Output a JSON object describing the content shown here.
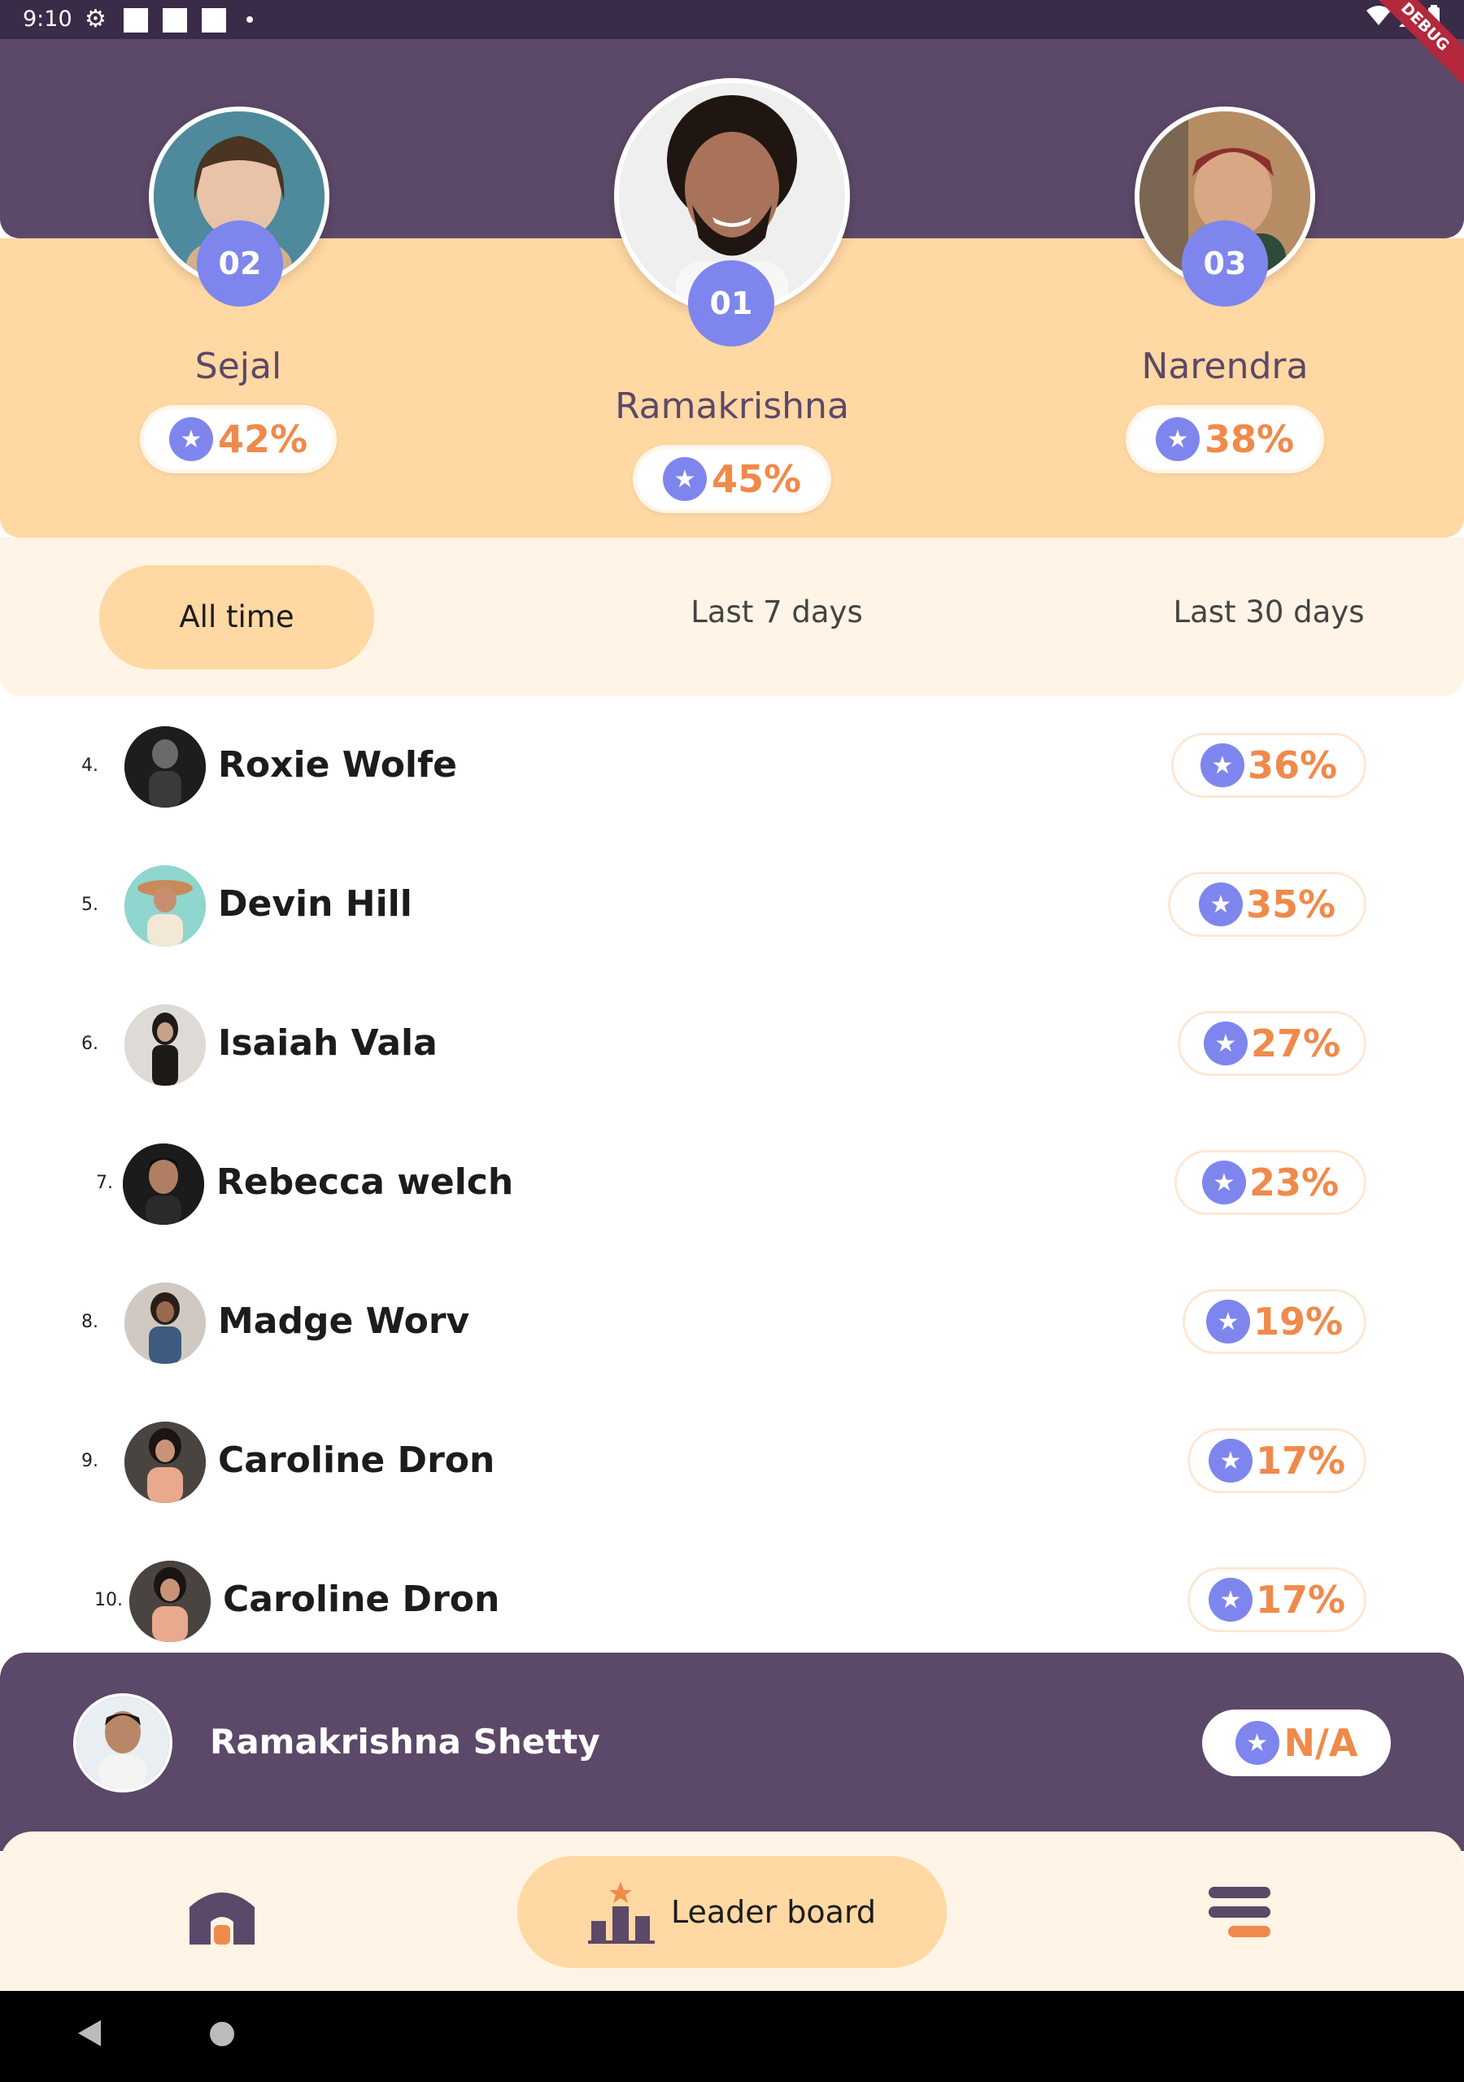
{
  "status_bar": {
    "time": "9:10",
    "debug_label": "DEBUG"
  },
  "podium": [
    {
      "rank": "02",
      "name": "Sejal",
      "score": "42%"
    },
    {
      "rank": "01",
      "name": "Ramakrishna",
      "score": "45%"
    },
    {
      "rank": "03",
      "name": "Narendra",
      "score": "38%"
    }
  ],
  "tabs": [
    {
      "label": "All time",
      "active": true
    },
    {
      "label": "Last 7 days",
      "active": false
    },
    {
      "label": "Last 30 days",
      "active": false
    }
  ],
  "leaderboard": [
    {
      "rank": "4.",
      "name": "Roxie Wolfe",
      "score": "36%"
    },
    {
      "rank": "5.",
      "name": "Devin Hill",
      "score": "35%"
    },
    {
      "rank": "6.",
      "name": "Isaiah Vala",
      "score": "27%"
    },
    {
      "rank": "7.",
      "name": "Rebecca welch",
      "score": "23%"
    },
    {
      "rank": "8.",
      "name": "Madge Worv",
      "score": "19%"
    },
    {
      "rank": "9.",
      "name": "Caroline Dron",
      "score": "17%"
    },
    {
      "rank": "10.",
      "name": "Caroline Dron",
      "score": "17%"
    }
  ],
  "current_user": {
    "name": "Ramakrishna Shetty",
    "score": "N/A"
  },
  "bottom_nav": {
    "home_icon": "home-icon",
    "leader_label": "Leader board",
    "menu_icon": "menu-icon"
  },
  "colors": {
    "primary": "#5c4868",
    "peach": "#ffd8a3",
    "cream": "#fff4e5",
    "accent_blue": "#7e86ee",
    "score_orange": "#f08a4b"
  }
}
